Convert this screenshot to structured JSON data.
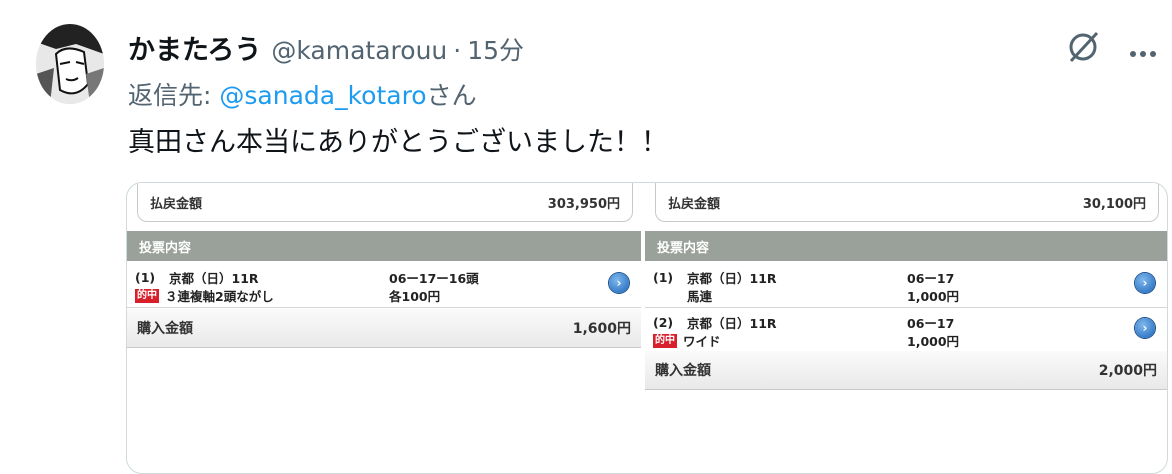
{
  "tweet": {
    "display_name": "かまたろう",
    "handle": "@kamatarouu",
    "separator": "·",
    "time": "15分",
    "reply_prefix": "返信先: ",
    "reply_mention": "@sanada_kotaro",
    "reply_suffix": "さん",
    "text": "真田さん本当にありがとうございました！！",
    "icons": [
      "grok-icon",
      "more-icon"
    ]
  },
  "left_panel": {
    "payout_label": "払戻金額",
    "payout_value": "303,950円",
    "section_title": "投票内容",
    "bets": [
      {
        "num": "(1)",
        "race": "京都（日）11R",
        "combo": "06ー17ー16頭",
        "hit": "的中",
        "type": "３連複軸2頭ながし",
        "amount": "各100円"
      }
    ],
    "total_label": "購入金額",
    "total_value": "1,600円"
  },
  "right_panel": {
    "payout_label": "払戻金額",
    "payout_value": "30,100円",
    "section_title": "投票内容",
    "bets": [
      {
        "num": "(1)",
        "race": "京都（日）11R",
        "combo": "06ー17",
        "hit": "",
        "type": "馬連",
        "amount": "1,000円"
      },
      {
        "num": "(2)",
        "race": "京都（日）11R",
        "combo": "06ー17",
        "hit": "的中",
        "type": "ワイド",
        "amount": "1,000円"
      }
    ],
    "total_label": "購入金額",
    "total_value": "2,000円"
  },
  "colors": {
    "link": "#1d9bf0",
    "hit_badge": "#d8202c",
    "section_header": "#9aa09a"
  }
}
